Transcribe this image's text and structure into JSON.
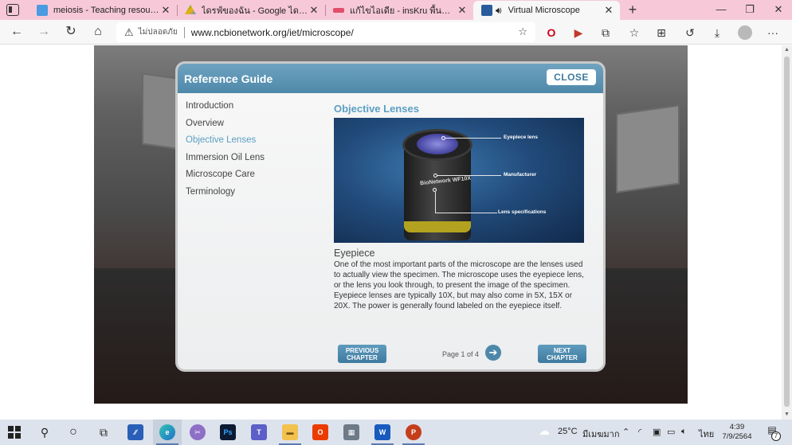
{
  "browser": {
    "tabs": [
      {
        "label": "meiosis - Teaching resources",
        "favicon_color": "#4a9be0"
      },
      {
        "label": "ไดรฟ์ของฉัน - Google ไดรฟ์",
        "favicon_color": "#f4b400"
      },
      {
        "label": "แก้ไขไอเดีย - insKru พื้นที่แบ่งปันไอเดียการสอน",
        "favicon_color": "#e24d6a"
      },
      {
        "label": "Virtual Microscope",
        "favicon_color": "#2a5c9c",
        "active": true
      }
    ],
    "new_tab_icon": "+",
    "security_label": "ไม่ปลอดภัย",
    "url": "www.ncbionetwork.org/iet/microscope/"
  },
  "guide": {
    "title": "Reference Guide",
    "close_label": "CLOSE",
    "toc": [
      {
        "label": "Introduction"
      },
      {
        "label": "Overview"
      },
      {
        "label": "Objective Lenses",
        "active": true
      },
      {
        "label": "Immersion Oil Lens"
      },
      {
        "label": "Microscope Care"
      },
      {
        "label": "Terminology"
      }
    ],
    "section_title": "Objective Lenses",
    "figure": {
      "brand_text": "BioNetwork WF10X",
      "callouts": [
        "Eyepiece lens",
        "Manufacturer",
        "Lens specifications"
      ]
    },
    "subtitle": "Eyepiece",
    "body": "One of the most important parts of the microscope are the lenses used to actually view the specimen. The microscope uses the eyepiece lens, or the lens you look through, to present the image of the specimen. Eyepiece lenses are typically 10X, but may also come in 5X, 15X or 20X. The power is generally found labeled on the eyepiece itself.",
    "prev_label": "PREVIOUS CHAPTER",
    "next_label": "NEXT CHAPTER",
    "page_label": "Page 1 of 4"
  },
  "taskbar": {
    "temperature": "25°C",
    "weather": "มีเมฆมาก",
    "language": "ไทย",
    "time": "4:39",
    "date": "7/9/2564",
    "notification_count": "7"
  }
}
